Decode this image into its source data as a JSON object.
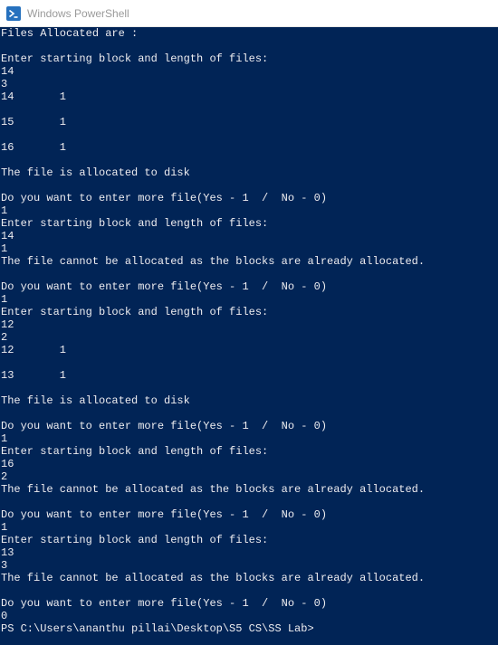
{
  "window": {
    "title": "Windows PowerShell",
    "icon": "powershell-icon",
    "background": "#012456",
    "text_color": "#eeedf0"
  },
  "console": {
    "lines": [
      "Files Allocated are :",
      "",
      "Enter starting block and length of files:",
      "14",
      "3",
      "14       1",
      "",
      "15       1",
      "",
      "16       1",
      "",
      "The file is allocated to disk",
      "",
      "Do you want to enter more file(Yes - 1  /  No - 0)",
      "1",
      "Enter starting block and length of files:",
      "14",
      "1",
      "The file cannot be allocated as the blocks are already allocated.",
      "",
      "Do you want to enter more file(Yes - 1  /  No - 0)",
      "1",
      "Enter starting block and length of files:",
      "12",
      "2",
      "12       1",
      "",
      "13       1",
      "",
      "The file is allocated to disk",
      "",
      "Do you want to enter more file(Yes - 1  /  No - 0)",
      "1",
      "Enter starting block and length of files:",
      "16",
      "2",
      "The file cannot be allocated as the blocks are already allocated.",
      "",
      "Do you want to enter more file(Yes - 1  /  No - 0)",
      "1",
      "Enter starting block and length of files:",
      "13",
      "3",
      "The file cannot be allocated as the blocks are already allocated.",
      "",
      "Do you want to enter more file(Yes - 1  /  No - 0)",
      "0",
      "PS C:\\Users\\ananthu pillai\\Desktop\\S5 CS\\SS Lab>"
    ]
  }
}
